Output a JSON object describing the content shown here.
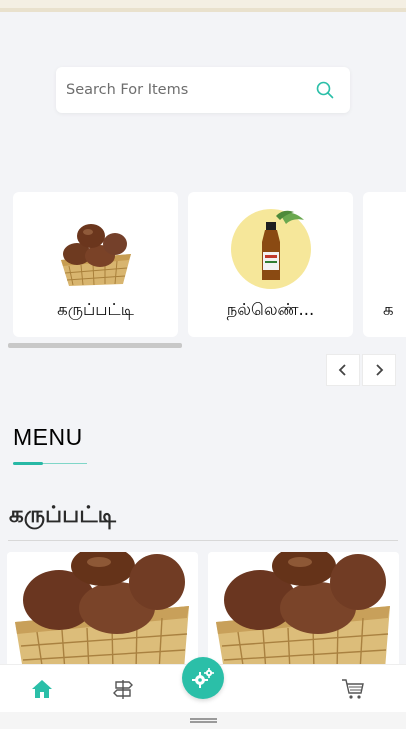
{
  "search": {
    "placeholder": "Search For Items"
  },
  "categories": [
    {
      "label": "கருப்பட்டி",
      "image": "jaggery-basket"
    },
    {
      "label": "நல்லெண்...",
      "image": "sesame-oil-bottle"
    },
    {
      "label": "க",
      "image": "partial-card"
    }
  ],
  "menu": {
    "title": "MENU"
  },
  "section": {
    "title": "கருப்பட்டி"
  },
  "products": [
    {
      "image": "jaggery-basket"
    },
    {
      "image": "jaggery-basket"
    }
  ],
  "bottom_nav": {
    "items": [
      {
        "icon": "home-icon",
        "active": true
      },
      {
        "icon": "signpost-icon",
        "active": false
      },
      {
        "icon": "settings-gears-icon",
        "active": false
      },
      {
        "icon": "cart-icon",
        "active": false
      }
    ]
  },
  "colors": {
    "accent": "#2bbfa8",
    "background": "#f3f4f7",
    "card": "#ffffff"
  }
}
